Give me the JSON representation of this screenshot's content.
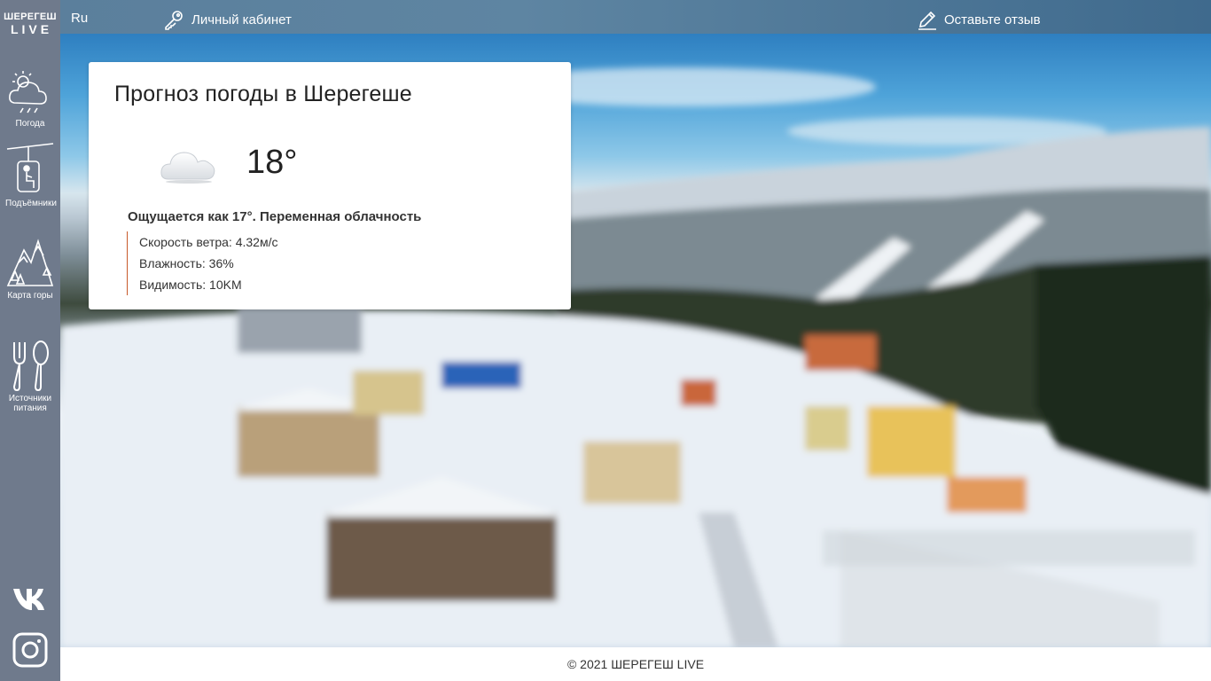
{
  "brand": {
    "line1": "ШЕРЕГЕШ",
    "line2": "LIVE"
  },
  "sidebar": {
    "items": [
      {
        "label": "Погода",
        "icon": "weather-icon"
      },
      {
        "label": "Подъёмники",
        "icon": "ski-lift-icon"
      },
      {
        "label": "Карта горы",
        "icon": "mountain-map-icon"
      },
      {
        "label": "Источники питания",
        "icon": "fork-spoon-icon"
      }
    ],
    "social": [
      {
        "name": "vk-icon"
      },
      {
        "name": "instagram-icon"
      }
    ]
  },
  "topbar": {
    "language": "Ru",
    "cabinet_label": "Личный кабинет",
    "review_label": "Оставьте отзыв"
  },
  "weather": {
    "title": "Прогноз погоды в Шерегеше",
    "temperature": "18°",
    "condition_icon": "cloud-icon",
    "feels_like": "Ощущается как 17°. Переменная облачность",
    "wind": "Скорость ветра: 4.32м/с",
    "humidity": "Влажность: 36%",
    "visibility": "Видимость: 10KM"
  },
  "footer": {
    "copyright": "© 2021 ШЕРЕГЕШ LIVE"
  },
  "colors": {
    "sidebar": "#6f7a8c",
    "topbar": "#5b7f9c",
    "accent_line": "#c85a2a"
  }
}
